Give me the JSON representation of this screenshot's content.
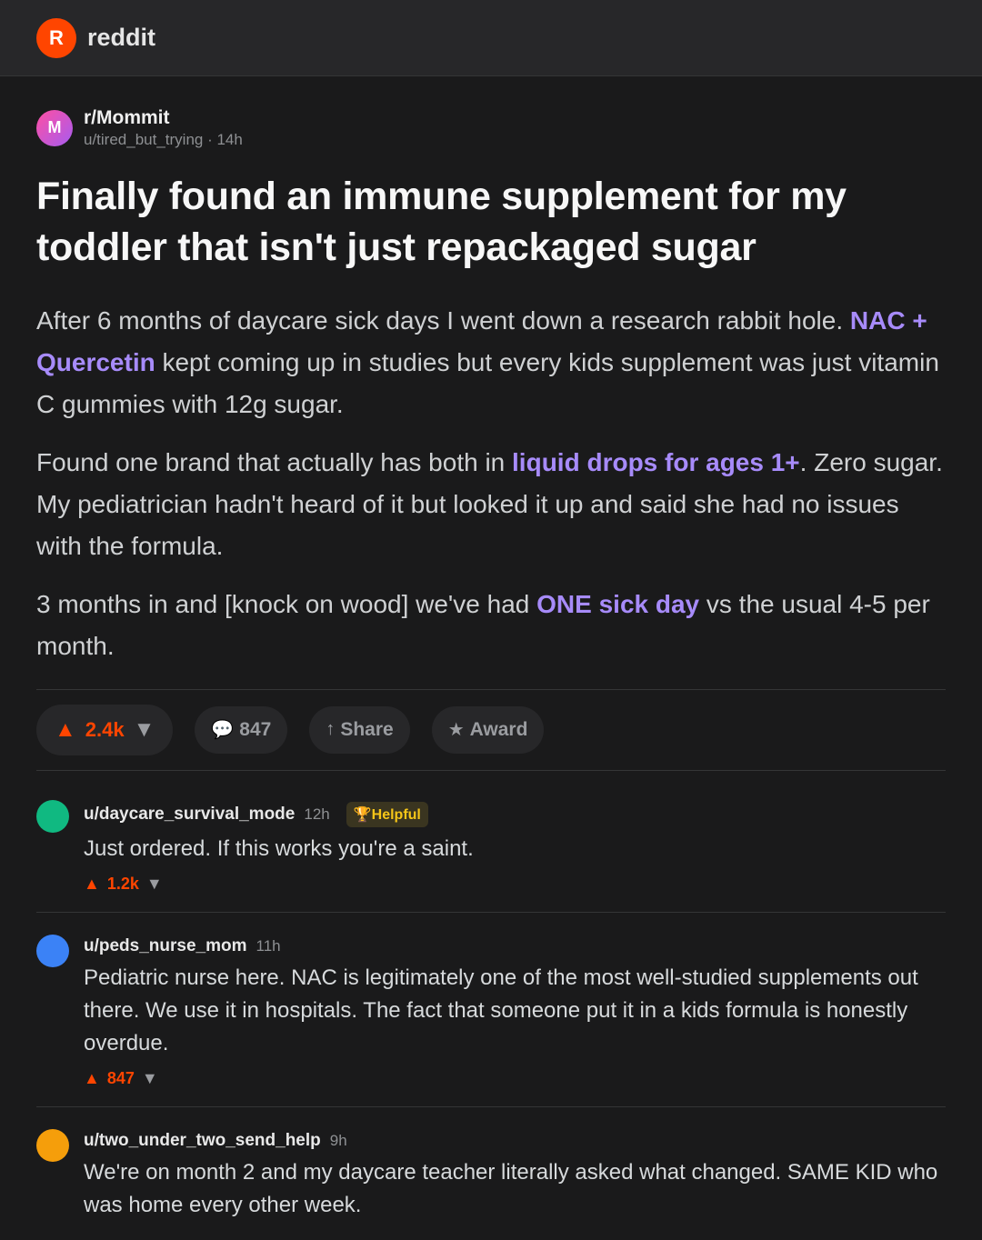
{
  "header": {
    "logo_letter": "R",
    "logo_text": "reddit"
  },
  "post": {
    "subreddit_avatar_letter": "M",
    "subreddit": "r/Mommit",
    "author_line": "u/tired_but_trying · 14h",
    "title": "Finally found an immune supplement for my toddler that isn't just repackaged sugar",
    "p1_a": "After 6 months of daycare sick days I went down a research rabbit hole. ",
    "p1_hl": "NAC + Quercetin",
    "p1_b": " kept coming up in studies but every kids supplement was just vitamin C gummies with 12g sugar.",
    "p2_a": "Found one brand that actually has both in ",
    "p2_hl": "liquid drops for ages 1+",
    "p2_b": ". Zero sugar. My pediatrician hadn't heard of it but looked it up and said she had no issues with the formula.",
    "p3_a": "3 months in and [knock on wood] we've had ",
    "p3_hl": "ONE sick day",
    "p3_b": " vs the usual 4-5 per month."
  },
  "actions": {
    "upvote_icon": "upvote-arrow",
    "votes": "2.4k",
    "comments": "847",
    "share": "Share",
    "award": "Award"
  },
  "comments": [
    {
      "user": "u/daycare_survival_mode",
      "time": "12h",
      "flair": "Helpful",
      "text": "Just ordered. If this works you're a saint.",
      "votes": "1.2k",
      "avatar_color": "#10b981"
    },
    {
      "user": "u/peds_nurse_mom",
      "time": "11h",
      "text": "Pediatric nurse here. NAC is legitimately one of the most well-studied supplements out there. We use it in hospitals. The fact that someone put it in a kids formula is honestly overdue.",
      "votes": "847",
      "avatar_color": "#3b82f6"
    },
    {
      "user": "u/two_under_two_send_help",
      "time": "9h",
      "text": "We're on month 2 and my daycare teacher literally asked what changed. SAME KID who was home every other week.",
      "avatar_color": "#f59e0b"
    }
  ],
  "colors": {
    "accent": "#ff4500",
    "highlight": "#a78bfa",
    "background": "#1a1a1b"
  }
}
